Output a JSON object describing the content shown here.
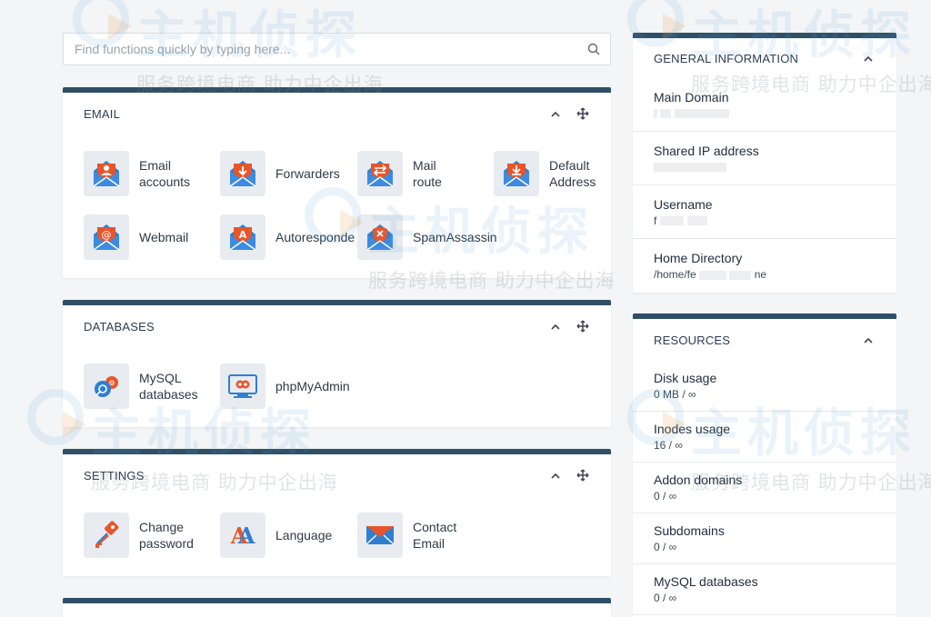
{
  "search": {
    "placeholder": "Find functions quickly by typing here..."
  },
  "email": {
    "title": "EMAIL",
    "items": [
      {
        "label": "Email accounts",
        "icon": "email-accounts-icon"
      },
      {
        "label": "Forwarders",
        "icon": "forwarders-icon"
      },
      {
        "label": "Mail route",
        "icon": "mail-route-icon"
      },
      {
        "label": "Default Address",
        "icon": "default-address-icon"
      },
      {
        "label": "Webmail",
        "icon": "webmail-icon"
      },
      {
        "label": "Autoresponde",
        "icon": "autoresponder-icon"
      },
      {
        "label": "SpamAssassin",
        "icon": "spamassassin-icon"
      }
    ]
  },
  "databases": {
    "title": "DATABASES",
    "items": [
      {
        "label": "MySQL databases",
        "icon": "mysql-icon"
      },
      {
        "label": "phpMyAdmin",
        "icon": "phpmyadmin-icon"
      }
    ]
  },
  "settings": {
    "title": "SETTINGS",
    "items": [
      {
        "label": "Change password",
        "icon": "key-icon"
      },
      {
        "label": "Language",
        "icon": "language-icon"
      },
      {
        "label": "Contact Email",
        "icon": "contact-email-icon"
      }
    ]
  },
  "general": {
    "title": "GENERAL INFORMATION",
    "rows": [
      {
        "key": "Main Domain",
        "value": ""
      },
      {
        "key": "Shared IP address",
        "value": ""
      },
      {
        "key": "Username",
        "value": "f"
      },
      {
        "key": "Home Directory",
        "value": "/home/fe"
      }
    ],
    "home_suffix": "ne"
  },
  "resources": {
    "title": "RESOURCES",
    "rows": [
      {
        "key": "Disk usage",
        "value": "0 MB / ∞"
      },
      {
        "key": "Inodes usage",
        "value": "16 / ∞"
      },
      {
        "key": "Addon domains",
        "value": "0 / ∞"
      },
      {
        "key": "Subdomains",
        "value": "0 / ∞"
      },
      {
        "key": "MySQL databases",
        "value": "0 / ∞"
      }
    ]
  },
  "watermark": {
    "brand": "主机侦探",
    "slogan": "服务跨境电商 助力中企出海"
  },
  "colors": {
    "panel_border": "#2f4f66",
    "icon_orange": "#e8552a",
    "icon_blue": "#2f7fd1"
  }
}
